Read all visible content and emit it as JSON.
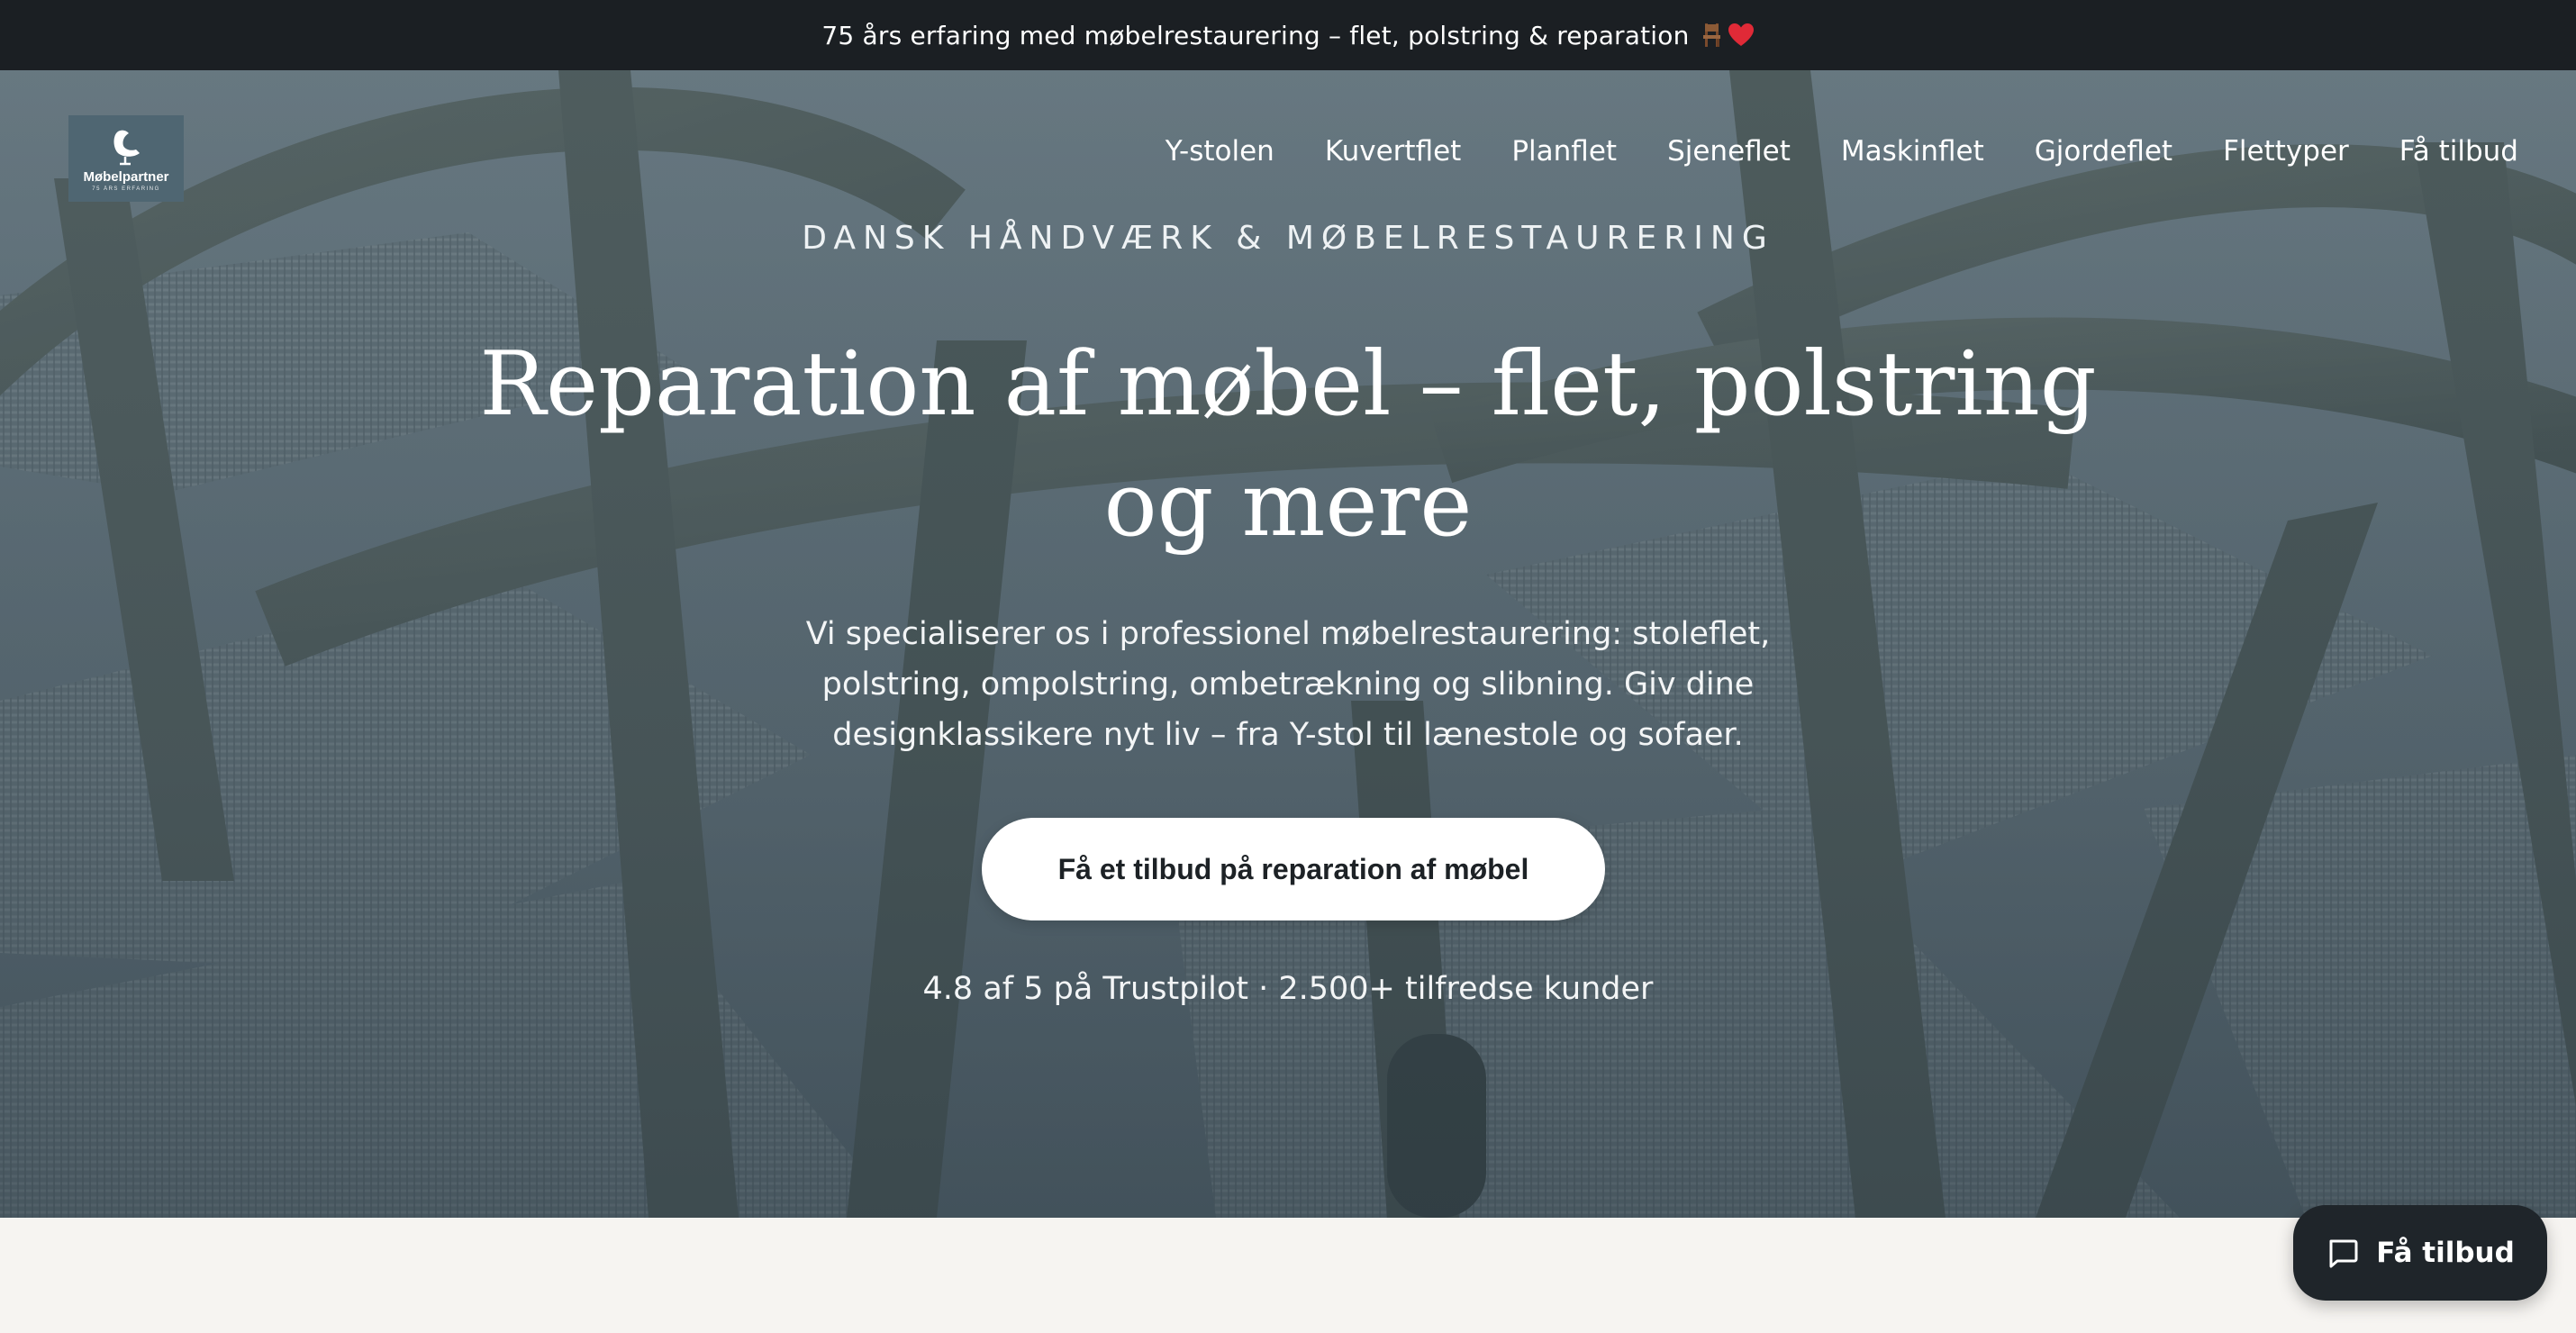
{
  "announcement": {
    "text": "75 års erfaring med møbelrestaurering – flet, polstring & reparation",
    "icons": [
      "chair-icon",
      "heart-icon"
    ]
  },
  "brand": {
    "logo_name": "Møbelpartner",
    "logo_tagline": "75 ÅRS ERFARING"
  },
  "nav": {
    "items": [
      "Y-stolen",
      "Kuvertflet",
      "Planflet",
      "Sjeneflet",
      "Maskinflet",
      "Gjordeflet",
      "Flettyper",
      "Få tilbud"
    ]
  },
  "hero": {
    "eyebrow": "DANSK HÅNDVÆRK & MØBELRESTAURERING",
    "headline": "Reparation af møbel – flet, polstring og mere",
    "lead": "Vi specialiserer os i professionel møbelrestaurering: stoleflet, polstring, ompolstring, ombetrækning og slibning. Giv dine designklassikere nyt liv – fra Y-stol til lænestole og sofaer.",
    "cta_label": "Få et tilbud på reparation af møbel",
    "rating_text": "4.8 af 5 på Trustpilot · 2.500+ tilfredse kunder"
  },
  "chat": {
    "label": "Få tilbud",
    "icon": "chat-bubble-icon"
  },
  "colors": {
    "topbar_bg": "#1b1f23",
    "hero_overlay": "#3c4e58",
    "logo_bg": "#4f6672",
    "cta_bg": "#ffffff",
    "chat_bg": "#1f252a",
    "page_bg": "#f6f4f1"
  }
}
